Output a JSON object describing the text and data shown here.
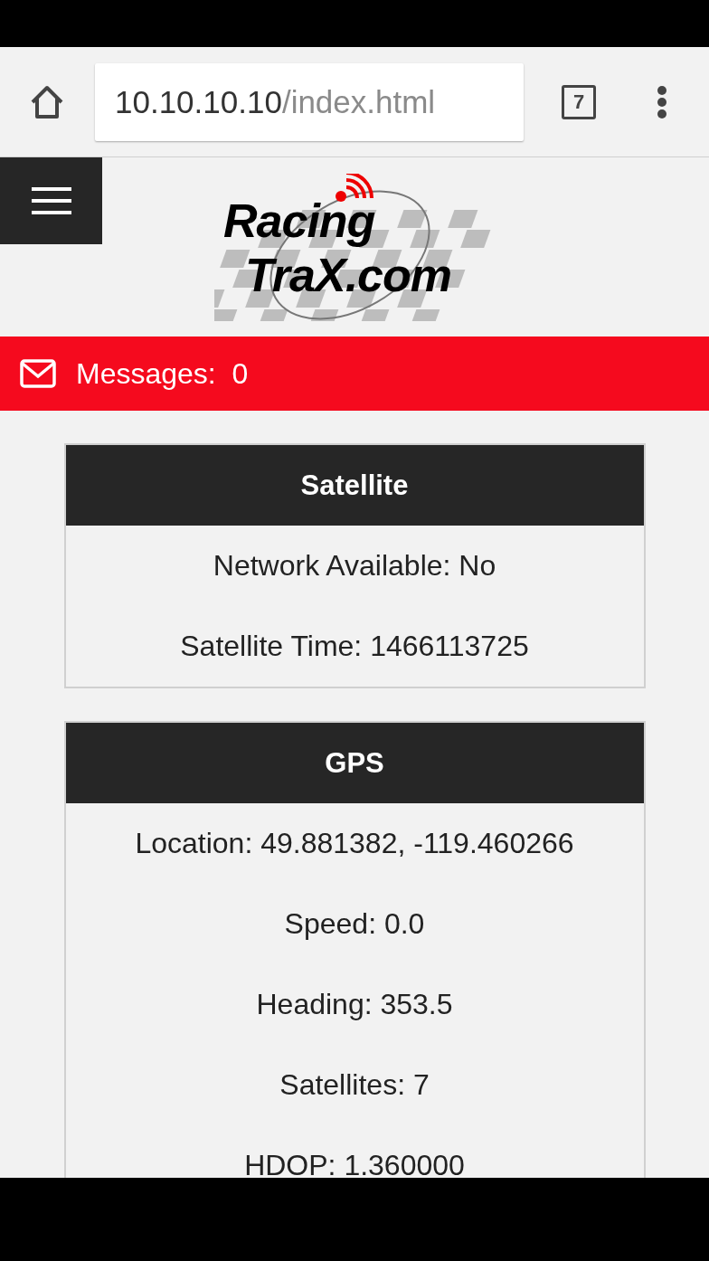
{
  "browser": {
    "url_host": "10.10.10.10",
    "url_path": "/index.html",
    "tab_count": "7"
  },
  "logo": {
    "line_1": "Racing",
    "line_2": "TraX.com"
  },
  "messages": {
    "label": "Messages:",
    "count": "0"
  },
  "cards": [
    {
      "title": "Satellite",
      "rows": [
        "Network Available: No",
        "Satellite Time: 1466113725"
      ]
    },
    {
      "title": "GPS",
      "rows": [
        "Location: 49.881382, -119.460266",
        "Speed: 0.0",
        "Heading: 353.5",
        "Satellites: 7",
        "HDOP: 1.360000"
      ]
    }
  ]
}
